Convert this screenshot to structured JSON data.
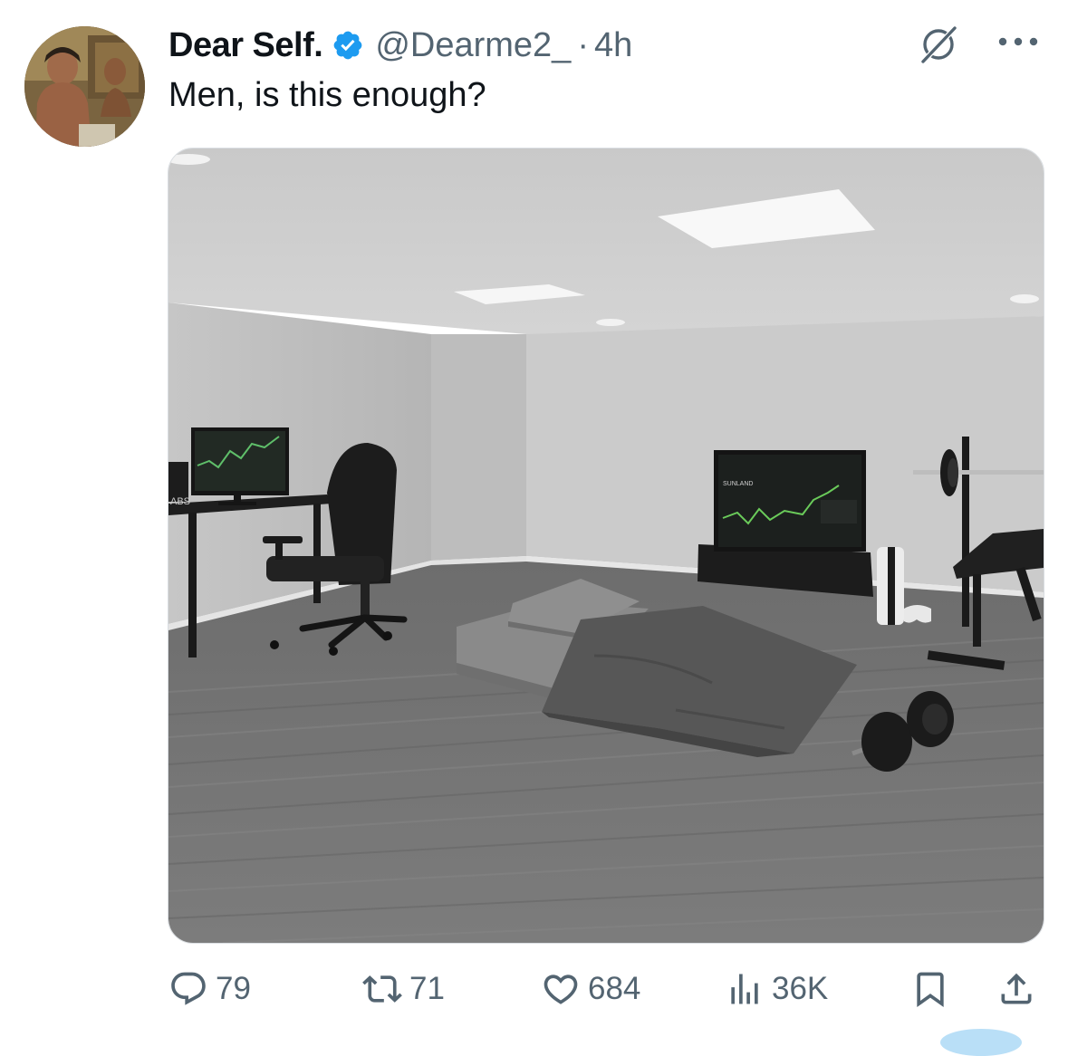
{
  "tweet": {
    "display_name": "Dear Self.",
    "handle": "@Dearme2_",
    "separator": "·",
    "time": "4h",
    "text": "Men, is this enough?",
    "verified": true
  },
  "media": {
    "description_icons": [
      "monitor-icon",
      "gaming-chair-icon",
      "tv-icon",
      "mattress-icon",
      "barbell-rack-icon",
      "dumbbell-icon",
      "console-icon"
    ],
    "desk_sign_text": "ABS",
    "tv_screen_text": "SUNLAND"
  },
  "actions": {
    "replies": "79",
    "reposts": "71",
    "likes": "684",
    "views": "36K"
  },
  "colors": {
    "text_primary": "#0f1419",
    "text_secondary": "#536471",
    "verified_blue": "#1d9bf0"
  },
  "icons": {
    "verified": "verified-badge-icon",
    "grok": "grok-icon",
    "more": "more-dots-icon",
    "reply": "reply-icon",
    "repost": "repost-icon",
    "like": "heart-icon",
    "views": "views-chart-icon",
    "bookmark": "bookmark-icon",
    "share": "share-icon"
  }
}
